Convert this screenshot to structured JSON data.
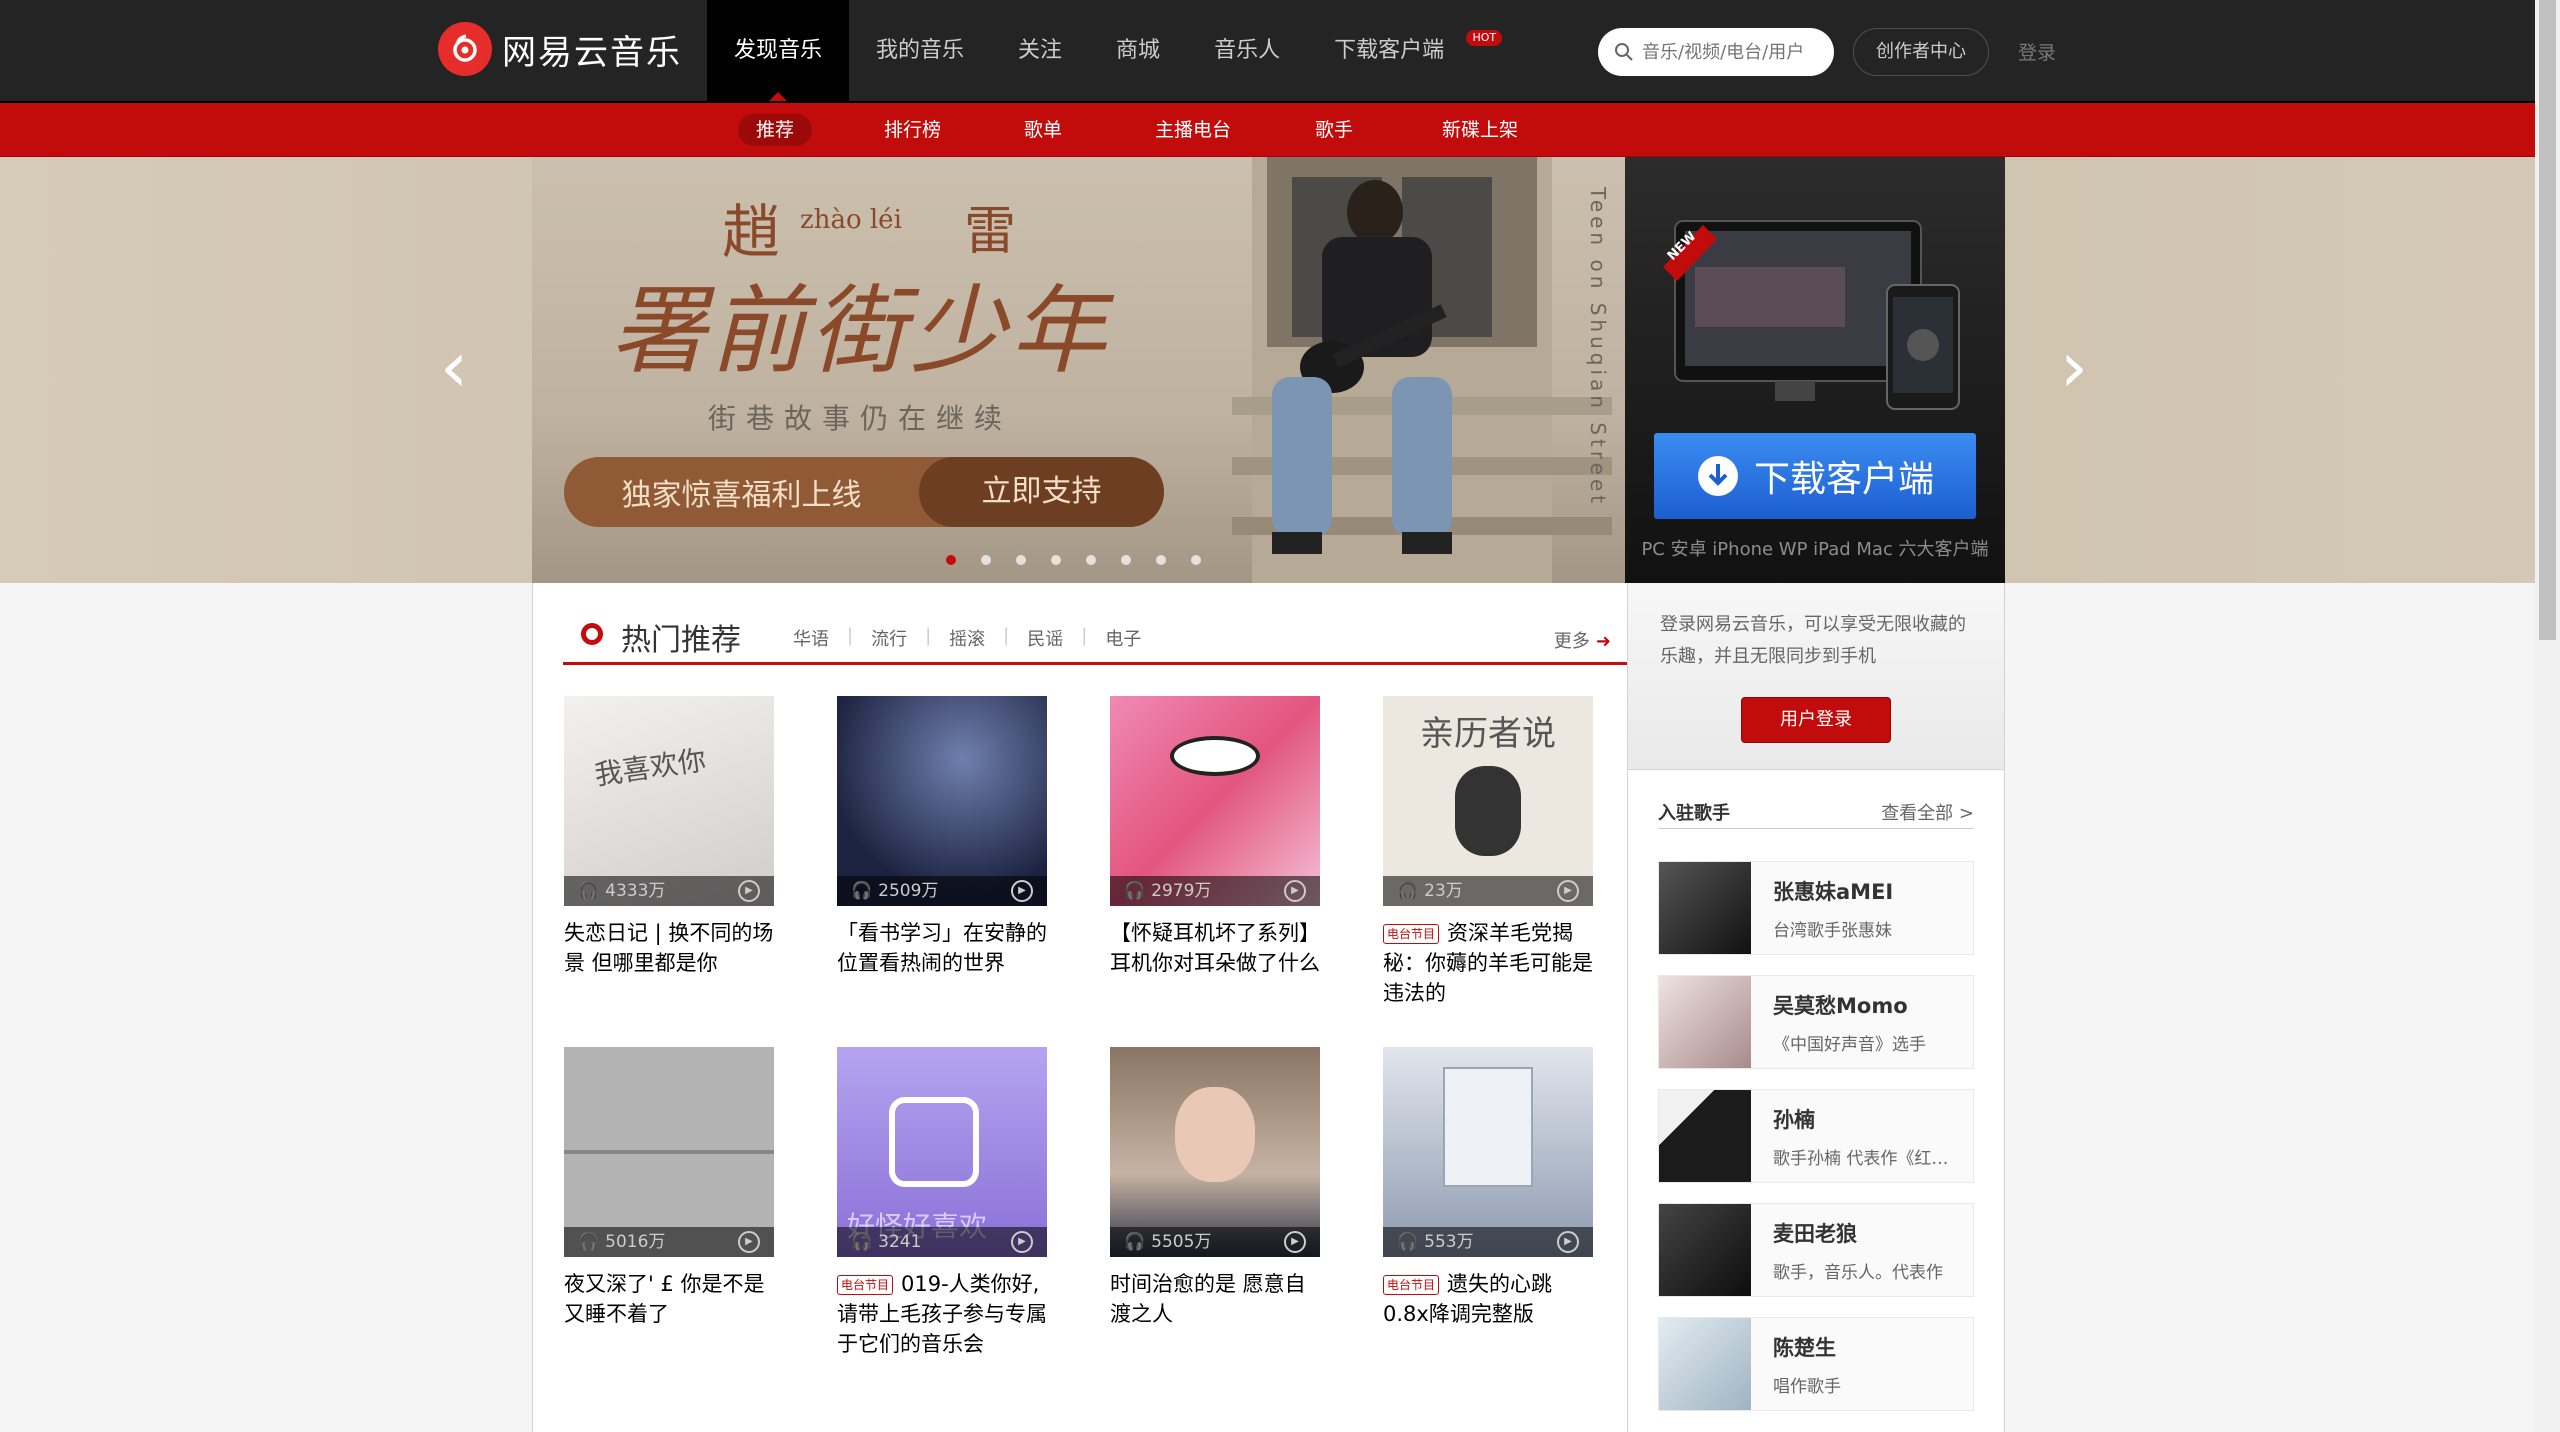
{
  "header": {
    "logo_text": "网易云音乐",
    "nav": [
      "发现音乐",
      "我的音乐",
      "关注",
      "商城",
      "音乐人",
      "下载客户端"
    ],
    "hot_badge": "HOT",
    "search_placeholder": "音乐/视频/电台/用户",
    "creator_label": "创作者中心",
    "login_label": "登录"
  },
  "subnav": [
    "推荐",
    "排行榜",
    "歌单",
    "主播电台",
    "歌手",
    "新碟上架"
  ],
  "banner": {
    "artist_zh_1": "趙",
    "artist_pinyin": "zhào léi",
    "artist_zh_2": "雷",
    "album_title": "署前街少年",
    "tagline": "街巷故事仍在继续",
    "promo_left": "独家惊喜福利上线",
    "promo_right": "立即支持",
    "vertical_text": "Teen on Shuqian Street",
    "new_tag": "NEW",
    "download_label": "下载客户端",
    "platforms": "PC 安卓 iPhone WP iPad Mac 六大客户端",
    "prev_arrow": "‹",
    "next_arrow": "›"
  },
  "hot": {
    "title": "热门推荐",
    "tags": [
      "华语",
      "流行",
      "摇滚",
      "民谣",
      "电子"
    ],
    "more": "更多",
    "radio_label": "电台节目",
    "cards": [
      {
        "plays": "4333万",
        "title": "失恋日记 | 换不同的场景 但哪里都是你",
        "radio": false,
        "color": "#d9d6d4"
      },
      {
        "plays": "2509万",
        "title": "「看书学习」在安静的位置看热闹的世界",
        "radio": false,
        "color": "#2b3552"
      },
      {
        "plays": "2979万",
        "title": "【怀疑耳机坏了系列】耳机你对耳朵做了什么",
        "radio": false,
        "color": "#e77ba6"
      },
      {
        "plays": "23万",
        "title": "资深羊毛党揭秘：你薅的羊毛可能是违法的",
        "radio": true,
        "color": "#e8e4dc",
        "cover_text": "亲历者说"
      },
      {
        "plays": "5016万",
        "title": "夜又深了' £ 你是不是又睡不着了",
        "radio": false,
        "color": "#9a9a9a"
      },
      {
        "plays": "3241",
        "title": "019-人类你好,请带上毛孩子参与专属于它们的音乐会",
        "radio": true,
        "color": "#9b83e0",
        "cover_text": "好怪好喜欢"
      },
      {
        "plays": "5505万",
        "title": "时间治愈的是 愿意自渡之人",
        "radio": false,
        "color": "#8f7a6a"
      },
      {
        "plays": "553万",
        "title": "遗失的心跳0.8x降调完整版",
        "radio": true,
        "color": "#aab4c4"
      }
    ]
  },
  "login_box": {
    "text": "登录网易云音乐，可以享受无限收藏的乐趣，并且无限同步到手机",
    "button": "用户登录"
  },
  "singers": {
    "title": "入驻歌手",
    "view_all": "查看全部 >",
    "list": [
      {
        "name": "张惠妹aMEI",
        "desc": "台湾歌手张惠妹",
        "color": "#3a3a3a"
      },
      {
        "name": "吴莫愁Momo",
        "desc": "《中国好声音》选手",
        "color": "#d9c9c9"
      },
      {
        "name": "孙楠",
        "desc": "歌手孙楠 代表作《红旗飘飘》",
        "color": "#2a2a2a"
      },
      {
        "name": "麦田老狼",
        "desc": "歌手，音乐人。代表作",
        "color": "#1e1e1e"
      },
      {
        "name": "陈楚生",
        "desc": "唱作歌手",
        "color": "#c9d4dc"
      }
    ]
  }
}
